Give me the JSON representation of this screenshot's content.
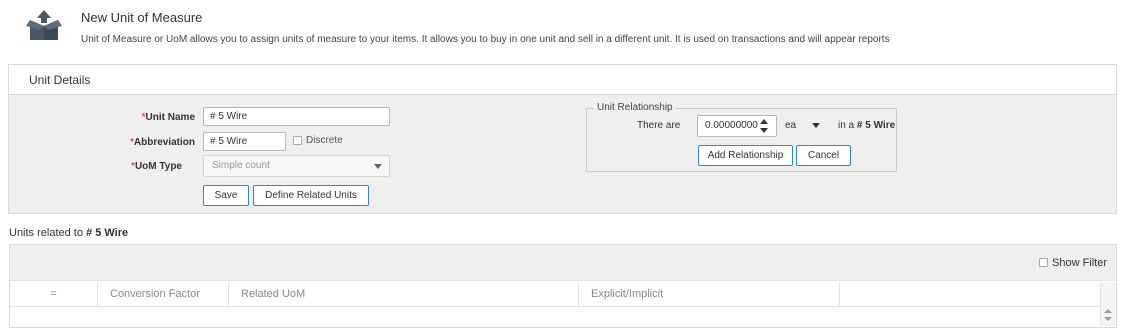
{
  "header": {
    "title": "New Unit of Measure",
    "description": "Unit of Measure or UoM allows you to assign units of measure to your items. It allows you to buy in one unit and sell in a different unit. It is used on transactions and will appear reports"
  },
  "unit_details": {
    "title": "Unit Details",
    "required_mark": "*",
    "unit_name_label": "Unit Name",
    "unit_name_value": "# 5 Wire",
    "abbreviation_label": "Abbreviation",
    "abbreviation_value": "# 5 Wire",
    "discrete_label": "Discrete",
    "uom_type_label": "UoM Type",
    "uom_type_value": "Simple count",
    "save_label": "Save",
    "define_related_label": "Define Related Units"
  },
  "relationship": {
    "legend": "Unit Relationship",
    "there_are": "There are",
    "quantity": "0.00000000",
    "unit": "ea",
    "in_a": "in a",
    "target": "# 5 Wire",
    "add_label": "Add Relationship",
    "cancel_label": "Cancel"
  },
  "related_units": {
    "title_prefix": "Units related to",
    "title_unit": "# 5 Wire",
    "show_filter": "Show Filter",
    "columns": [
      "=",
      "Conversion Factor",
      "Related UoM",
      "Explicit/Implicit"
    ]
  }
}
